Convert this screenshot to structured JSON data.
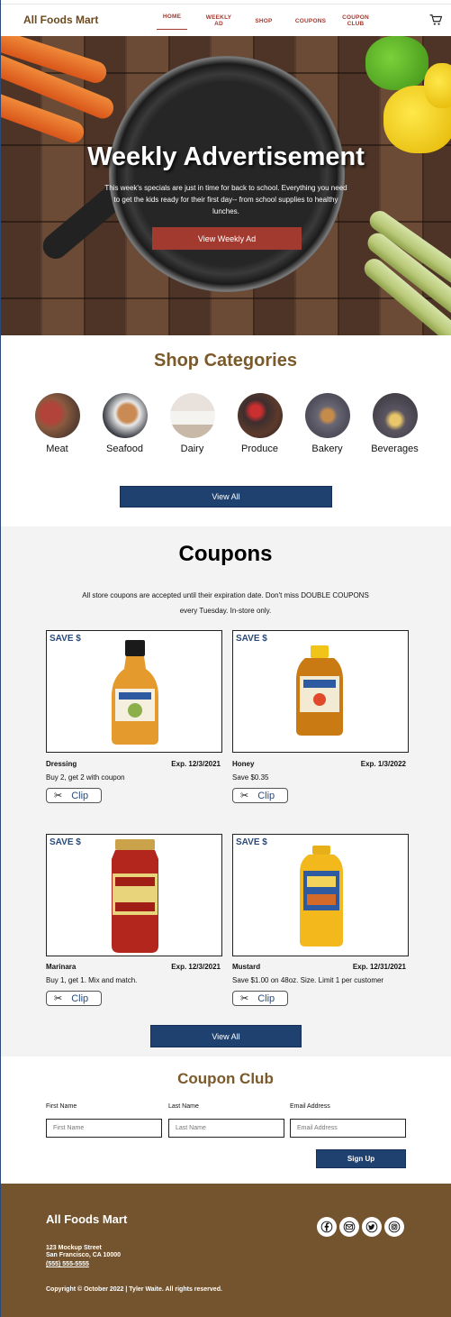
{
  "header": {
    "brand": "All Foods Mart",
    "nav": [
      {
        "label": "HOME"
      },
      {
        "label": "WEEKLY AD"
      },
      {
        "label": "SHOP"
      },
      {
        "label": "COUPONS"
      },
      {
        "label": "COUPON CLUB"
      }
    ],
    "cart_icon": "cart-icon"
  },
  "hero": {
    "title": "Weekly Advertisement",
    "text": "This week's specials are just in time for back to school. Everything you need to get the kids ready for their first day-- from school supplies to healthy lunches.",
    "button": "View Weekly Ad"
  },
  "categories": {
    "title": "Shop Categories",
    "items": [
      {
        "label": "Meat"
      },
      {
        "label": "Seafood"
      },
      {
        "label": "Dairy"
      },
      {
        "label": "Produce"
      },
      {
        "label": "Bakery"
      },
      {
        "label": "Beverages"
      }
    ],
    "view_all": "View All"
  },
  "coupons": {
    "title": "Coupons",
    "text": "All store coupons are accepted until their expiration date. Don't miss DOUBLE COUPONS every Tuesday. In-store only.",
    "items": [
      {
        "badge": "SAVE $",
        "name": "Dressing",
        "exp": "Exp. 12/3/2021",
        "desc": "Buy 2, get 2 with coupon",
        "clip": "Clip"
      },
      {
        "badge": "SAVE $",
        "name": "Honey",
        "exp": "Exp. 1/3/2022",
        "desc": "Save $0.35",
        "clip": "Clip"
      },
      {
        "badge": "SAVE $",
        "name": "Marinara",
        "exp": "Exp. 12/3/2021",
        "desc": "Buy 1, get 1. Mix and match.",
        "clip": "Clip"
      },
      {
        "badge": "SAVE $",
        "name": "Mustard",
        "exp": "Exp. 12/31/2021",
        "desc": "Save $1.00 on 48oz. Size. Limit 1 per customer",
        "clip": "Clip"
      }
    ],
    "view_all": "View All"
  },
  "club": {
    "title": "Coupon Club",
    "fields": [
      {
        "label": "First Name",
        "placeholder": "First Name"
      },
      {
        "label": "Last Name",
        "placeholder": "Last Name"
      },
      {
        "label": "Email Address",
        "placeholder": "Email Address"
      }
    ],
    "submit": "Sign Up"
  },
  "footer": {
    "brand": "All Foods Mart",
    "address_line1": "123 Mockup Street",
    "address_line2": "San Francisco, CA 10000",
    "phone": "(555) 555-5555",
    "copyright": "Copyright © October 2022 | Tyler Waite. All rights reserved.",
    "social": [
      "facebook-icon",
      "email-icon",
      "twitter-icon",
      "instagram-icon"
    ]
  },
  "colors": {
    "brand_brown": "#74542e",
    "accent_red": "#a33a30",
    "navy": "#1f4170"
  }
}
